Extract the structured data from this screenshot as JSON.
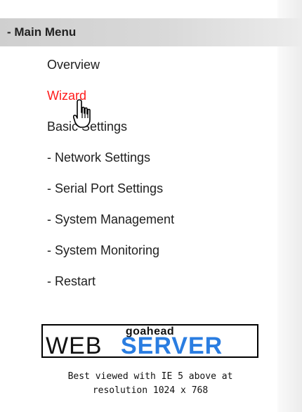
{
  "menu": {
    "header": "- Main Menu",
    "items": [
      {
        "label": "Overview"
      },
      {
        "label": "Wizard",
        "state": "hover"
      },
      {
        "label": "Basic Settings"
      },
      {
        "label": "- Network Settings"
      },
      {
        "label": "- Serial Port Settings"
      },
      {
        "label": "- System Management"
      },
      {
        "label": "- System Monitoring"
      },
      {
        "label": "- Restart"
      }
    ]
  },
  "logo": {
    "top_text": "goahead",
    "word1": "WEB",
    "word2": "SERVER",
    "accent_color": "#2a7de1"
  },
  "footer": {
    "line1": "Best viewed with IE 5 above at",
    "line2": "resolution 1024 x 768"
  },
  "colors": {
    "hover_link": "#ff1a1a",
    "text": "#1e1e1e",
    "header_bg": "#d3d3d3"
  },
  "cursor": "hand-pointer-icon"
}
